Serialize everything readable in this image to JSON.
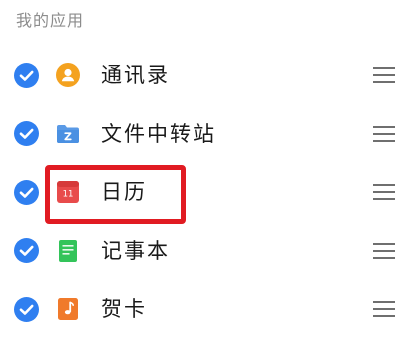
{
  "section": {
    "title": "我的应用"
  },
  "apps": [
    {
      "name": "通讯录",
      "icon": "contacts-icon",
      "checked": true,
      "color": "#f4a21f"
    },
    {
      "name": "文件中转站",
      "icon": "folder-icon",
      "checked": true,
      "color": "#4a90e2"
    },
    {
      "name": "日历",
      "icon": "calendar-icon",
      "checked": true,
      "color": "#e84b4b",
      "icon_text": "11"
    },
    {
      "name": "记事本",
      "icon": "notepad-icon",
      "checked": true,
      "color": "#33c45a"
    },
    {
      "name": "贺卡",
      "icon": "greeting-card-icon",
      "checked": true,
      "color": "#f07a2b"
    }
  ],
  "colors": {
    "checkbox": "#2f7ff0",
    "highlight": "#e11b22",
    "section_text": "#8c8c8c"
  }
}
